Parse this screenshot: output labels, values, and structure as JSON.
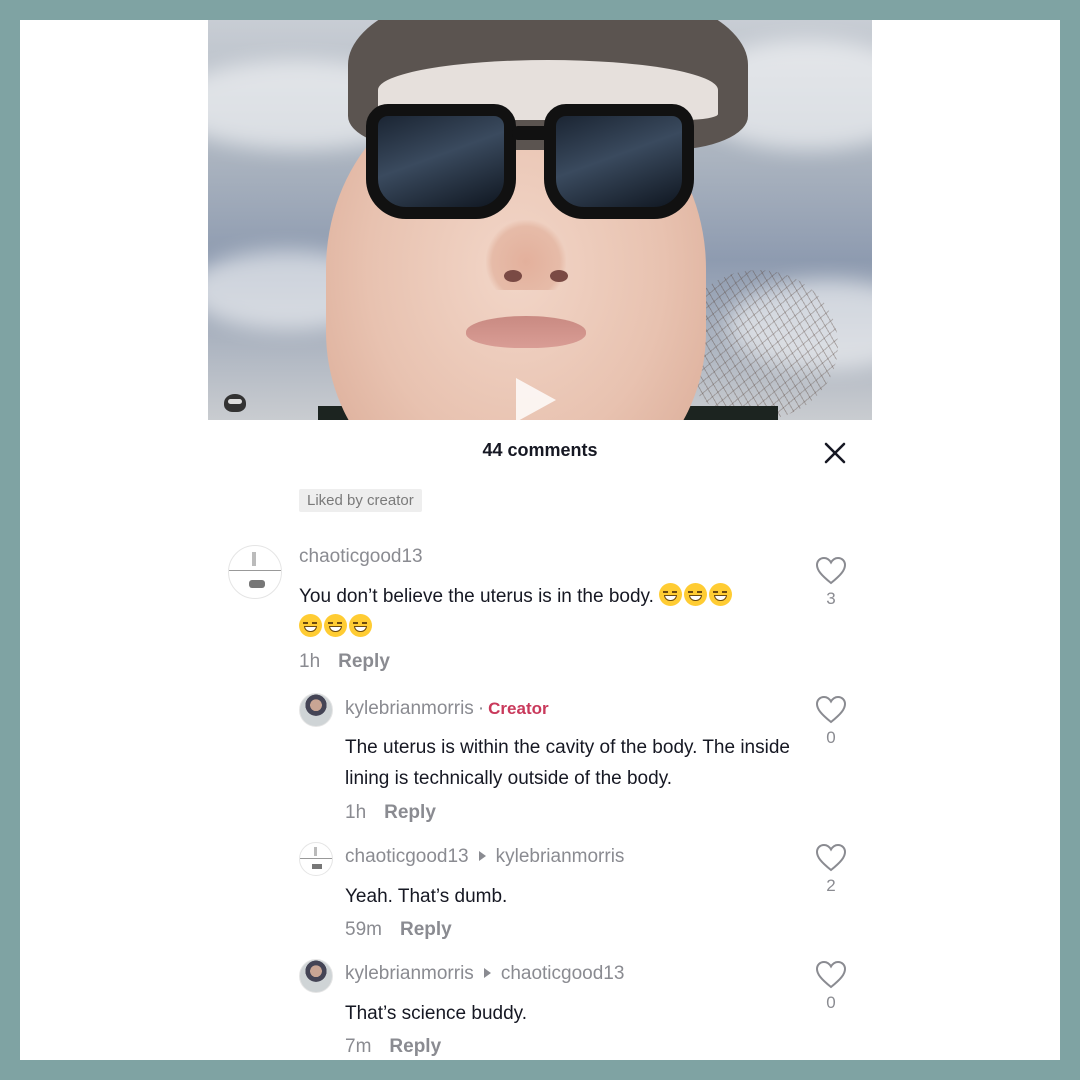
{
  "header": {
    "title": "44 comments"
  },
  "badge": "Liked by creator",
  "comments": [
    {
      "username": "chaoticgood13",
      "text": "You don’t believe the uterus is in the body.",
      "emoji_line1_count": 3,
      "emoji_line2_count": 3,
      "time": "1h",
      "reply_label": "Reply",
      "likes": "3"
    },
    {
      "username": "kylebrianmorris",
      "separator": "·",
      "role": "Creator",
      "text": "The uterus is within the cavity of the body. The inside lining is technically outside of the body.",
      "time": "1h",
      "reply_label": "Reply",
      "likes": "0"
    },
    {
      "username": "chaoticgood13",
      "reply_to": "kylebrianmorris",
      "text": "Yeah. That’s dumb.",
      "time": "59m",
      "reply_label": "Reply",
      "likes": "2"
    },
    {
      "username": "kylebrianmorris",
      "reply_to": "chaoticgood13",
      "text": "That’s science buddy.",
      "time": "7m",
      "reply_label": "Reply",
      "likes": "0"
    }
  ],
  "icons": {
    "close": "close-icon",
    "heart": "heart-outline-icon",
    "play": "play-icon",
    "emoji": "laughing-emoji-icon"
  },
  "colors": {
    "frame": "#7fa3a3",
    "creator": "#c9395b",
    "muted": "#8a8b91",
    "text": "#161823"
  }
}
